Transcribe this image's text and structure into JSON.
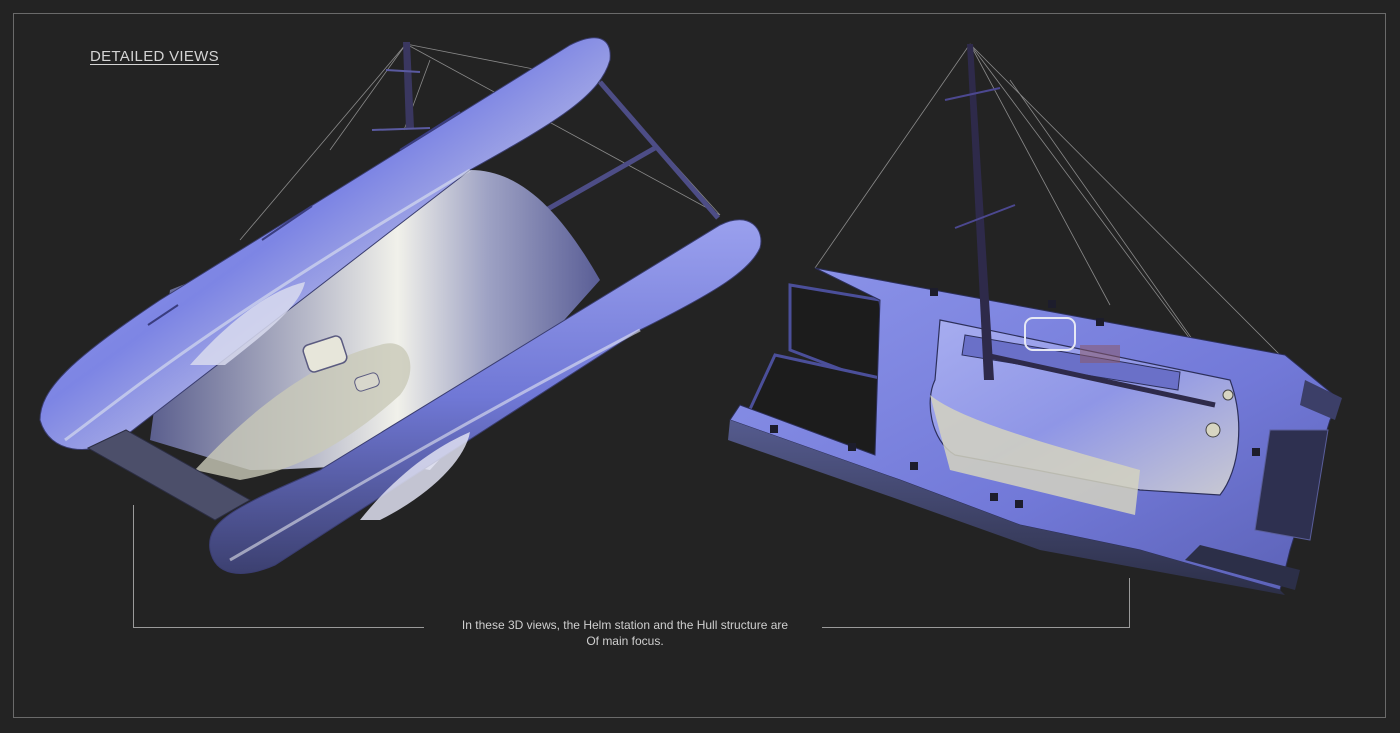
{
  "heading": "DETAILED VIEWS",
  "caption": {
    "line1": "In these 3D views, the Helm station and the Hull structure are",
    "line2": "Of main focus."
  },
  "views": [
    {
      "name": "catamaran-underside-view"
    },
    {
      "name": "catamaran-deck-view"
    }
  ],
  "colors": {
    "background": "#232323",
    "hull_blue": "#7c86e6",
    "hull_highlight": "#e8ecf0",
    "rigging": "#8a8a8a",
    "mast": "#2e2a4a"
  }
}
